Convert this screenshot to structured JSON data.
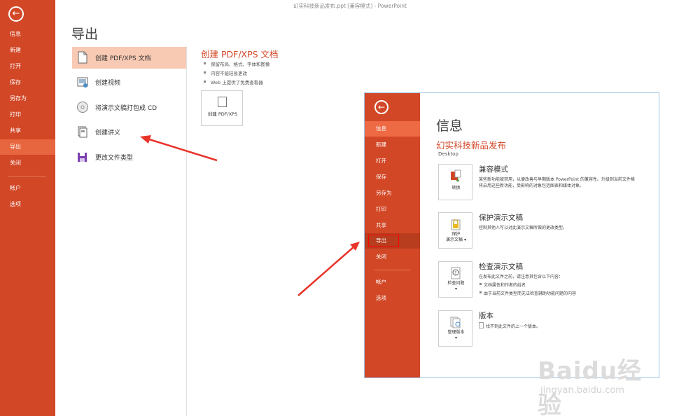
{
  "window": {
    "title": "幻实科技新品发布.ppt [兼容模式] - PowerPoint"
  },
  "nav": {
    "back": "←",
    "items": [
      "信息",
      "新建",
      "打开",
      "保存",
      "另存为",
      "打印",
      "共享",
      "导出",
      "关闭",
      "帐户",
      "选项"
    ],
    "active": "导出"
  },
  "export": {
    "heading": "导出",
    "items": [
      {
        "label": "创建 PDF/XPS 文档",
        "icon": "pdf-document-icon"
      },
      {
        "label": "创建视频",
        "icon": "video-icon"
      },
      {
        "label": "将演示文稿打包成 CD",
        "icon": "cd-icon"
      },
      {
        "label": "创建讲义",
        "icon": "handout-icon"
      },
      {
        "label": "更改文件类型",
        "icon": "change-file-type-icon"
      }
    ],
    "detail": {
      "title": "创建 PDF/XPS 文档",
      "bullets": [
        "保留布局、格式、字体和图像",
        "内容不能轻易更改",
        "Web 上提供了免费查看器"
      ],
      "button_label": "创建 PDF/XPS"
    }
  },
  "inset": {
    "nav_items": [
      "信息",
      "新建",
      "打开",
      "保存",
      "另存为",
      "打印",
      "共享",
      "导出",
      "关闭",
      "帐户",
      "选项"
    ],
    "heading": "信息",
    "file_name": "幻实科技新品发布",
    "location": "Desktop",
    "cards": [
      {
        "button_label": "转换",
        "title": "兼容模式",
        "text": [
          "某些新功能被禁用，以便改善与早期版本 PowerPoint 的兼容性。升级到当前文件格",
          "将启用这些新功能，受影响的对象包括图表和媒体对象。"
        ],
        "bullets": []
      },
      {
        "button_label": "保护\n演示文稿 ▾",
        "title": "保护演示文稿",
        "text": [
          "控制其他人可以对此演示文稿所做的更改类型。"
        ],
        "bullets": []
      },
      {
        "button_label": "检查问题\n▾",
        "title": "检查演示文稿",
        "text": [
          "在发布此文件之前，请注意其包含以下内容："
        ],
        "bullets": [
          "文档属性和作者的姓名",
          "由于当前文件类型而无法检查辅助功能问题的内容"
        ]
      },
      {
        "button_label": "管理版本\n▾",
        "title": "版本",
        "text": [
          "找不到此文件的上一个版本。"
        ],
        "bullets": []
      }
    ]
  },
  "watermark": {
    "brand": "Baidu经验",
    "url": "jingyan.baidu.com"
  },
  "colors": {
    "accent": "#d24726",
    "nav_active": "#e8663f",
    "selected_item": "#f8c9b3",
    "arrow": "#e8342a"
  }
}
